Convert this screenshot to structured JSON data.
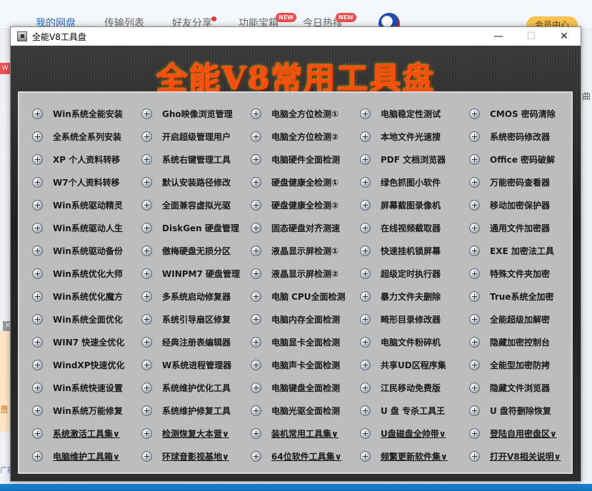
{
  "background": {
    "tabs": [
      {
        "label": "我的网盘",
        "active": true
      },
      {
        "label": "传输列表",
        "active": false
      },
      {
        "label": "好友分享",
        "active": false
      },
      {
        "label": "功能宝箱",
        "active": false
      },
      {
        "label": "今日热搜",
        "active": false
      }
    ],
    "new_badge": "NEW",
    "vip_label": "会员中心",
    "left_badge": "W",
    "left_close": "✕",
    "left_ad_text": "贵",
    "right_text": "曲",
    "bottom_left_text": "广客"
  },
  "window": {
    "title": "全能V8工具盘",
    "minimize": "—",
    "maximize": "☐",
    "close": "✕",
    "banner": "全能V8常用工具盘",
    "rows": [
      [
        {
          "label": "Win系统全能安装"
        },
        {
          "label": "Gho映像浏览管理"
        },
        {
          "label": "电脑全方位检测①"
        },
        {
          "label": "电脑稳定性测试"
        },
        {
          "label": "CMOS 密码清除"
        }
      ],
      [
        {
          "label": "全系统全系列安装"
        },
        {
          "label": "开启超级管理用户"
        },
        {
          "label": "电脑全方位检测②"
        },
        {
          "label": "本地文件光速搜"
        },
        {
          "label": "系统密码修改器"
        }
      ],
      [
        {
          "label": "XP 个人资料转移"
        },
        {
          "label": "系统右键管理工具"
        },
        {
          "label": "电脑硬件全面检测"
        },
        {
          "label": "PDF 文档浏览器"
        },
        {
          "label": "Office 密码破解"
        }
      ],
      [
        {
          "label": "W7个人资料转移"
        },
        {
          "label": "默认安装路径修改"
        },
        {
          "label": "硬盘健康全检测①"
        },
        {
          "label": "绿色抓图小软件"
        },
        {
          "label": "万能密码查看器"
        }
      ],
      [
        {
          "label": "Win系统驱动精灵"
        },
        {
          "label": "全面兼容虚拟光驱"
        },
        {
          "label": "硬盘健康全检测②"
        },
        {
          "label": "屏幕截图录像机"
        },
        {
          "label": "移动加密保护器"
        }
      ],
      [
        {
          "label": "Win系统驱动人生"
        },
        {
          "label": "DiskGen 硬盘管理"
        },
        {
          "label": "固态硬盘对齐测速"
        },
        {
          "label": "在线视频截取器"
        },
        {
          "label": "通用文件加密器"
        }
      ],
      [
        {
          "label": "Win系统驱动备份"
        },
        {
          "label": "傲梅硬盘无损分区"
        },
        {
          "label": "液晶显示屏检测①"
        },
        {
          "label": "快速挂机锁屏幕"
        },
        {
          "label": "EXE 加密法工具"
        }
      ],
      [
        {
          "label": "Win系统优化大师"
        },
        {
          "label": "WINPM7 硬盘管理"
        },
        {
          "label": "液晶显示屏检测②"
        },
        {
          "label": "超级定时执行器"
        },
        {
          "label": "特殊文件夹加密"
        }
      ],
      [
        {
          "label": "Win系统优化魔方"
        },
        {
          "label": "多系统启动修复器"
        },
        {
          "label": "电脑 CPU全面检测"
        },
        {
          "label": "暴力文件夫删除"
        },
        {
          "label": "True系统全加密"
        }
      ],
      [
        {
          "label": "Win系统全面优化"
        },
        {
          "label": "系统引导扇区修复"
        },
        {
          "label": "电脑内存全面检测"
        },
        {
          "label": "畸形目录修改器"
        },
        {
          "label": "全能超级加解密"
        }
      ],
      [
        {
          "label": "WIN7 快速全优化"
        },
        {
          "label": "经典注册表编辑器"
        },
        {
          "label": "电脑显卡全面检测"
        },
        {
          "label": "电脑文件粉碎机"
        },
        {
          "label": "隐藏加密控制台"
        }
      ],
      [
        {
          "label": "WindXP快速优化"
        },
        {
          "label": "W系统进程管理器"
        },
        {
          "label": "电脑声卡全面检测"
        },
        {
          "label": "共享UD区程序集"
        },
        {
          "label": "全能型加密防拷"
        }
      ],
      [
        {
          "label": "Win系统快速设置"
        },
        {
          "label": "系统维护优化工具"
        },
        {
          "label": "电脑键盘全面检测"
        },
        {
          "label": "江民移动免费版"
        },
        {
          "label": "隐藏文件浏览器"
        }
      ],
      [
        {
          "label": "Win系统万能修复"
        },
        {
          "label": "系统维护修复工具"
        },
        {
          "label": "电脑光驱全面检测"
        },
        {
          "label": "U 盘 专杀工具王"
        },
        {
          "label": "U 盘符删除恢复"
        }
      ],
      [
        {
          "label": "系统激活工具集∨",
          "link": true
        },
        {
          "label": "检测恢复大本营∨",
          "link": true
        },
        {
          "label": "装机常用工具集∨",
          "link": true
        },
        {
          "label": "U盘磁盘全帅带∨",
          "link": true
        },
        {
          "label": "登陆自用密盘区∨",
          "link": true
        }
      ],
      [
        {
          "label": "电脑维护工具箱∨",
          "link": true
        },
        {
          "label": "环球音影视基地∨",
          "link": true
        },
        {
          "label": "64位软件工具集∨",
          "link": true
        },
        {
          "label": "频繁更新软件集∨",
          "link": true
        },
        {
          "label": "打开V8相关说明∨",
          "link": true
        }
      ]
    ]
  }
}
